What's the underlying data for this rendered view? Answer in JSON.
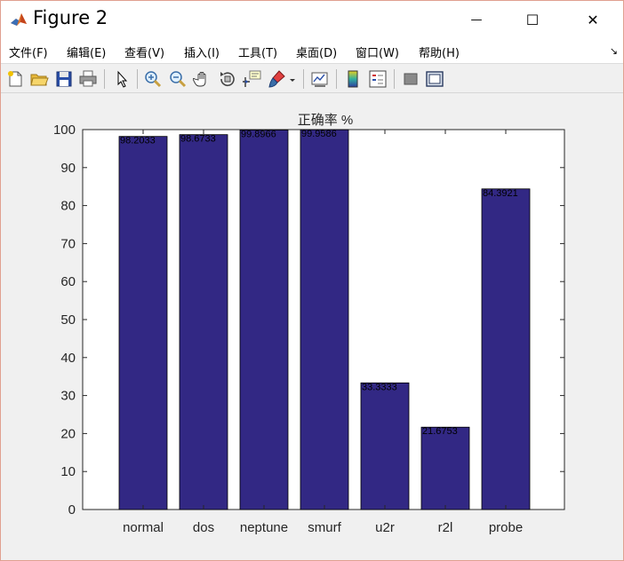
{
  "window": {
    "title": "Figure 2",
    "minimize_glyph": "—",
    "maximize_glyph": "☐",
    "close_glyph": "✕"
  },
  "menu": {
    "items": [
      "文件(F)",
      "编辑(E)",
      "查看(V)",
      "插入(I)",
      "工具(T)",
      "桌面(D)",
      "窗口(W)",
      "帮助(H)"
    ],
    "corner_glyph": "↘"
  },
  "toolbar": {
    "icons": [
      "new-figure-icon",
      "open-file-icon",
      "save-icon",
      "print-icon",
      "edit-plot-arrow-icon",
      "zoom-in-icon",
      "zoom-out-icon",
      "pan-hand-icon",
      "rotate-3d-icon",
      "data-cursor-icon",
      "brush-icon",
      "brush-dropdown-icon",
      "link-plot-icon",
      "colorbar-icon",
      "legend-icon",
      "hide-plot-tools-icon",
      "show-plot-tools-icon"
    ]
  },
  "colors": {
    "bar": "#322884",
    "axes_bg": "#ffffff",
    "figure_bg": "#f0f0f0"
  },
  "chart_data": {
    "type": "bar",
    "title": "正确率 %",
    "categories": [
      "normal",
      "dos",
      "neptune",
      "smurf",
      "u2r",
      "r2l",
      "probe"
    ],
    "values": [
      98.2033,
      98.6733,
      99.8966,
      99.9586,
      33.3333,
      21.6753,
      84.3921
    ],
    "value_labels": [
      "98.2033",
      "98.6733",
      "99.8966",
      "99.9586",
      "33.3333",
      "21.6753",
      "84.3921"
    ],
    "yticks": [
      0,
      10,
      20,
      30,
      40,
      50,
      60,
      70,
      80,
      90,
      100
    ],
    "ylim": [
      0,
      100
    ],
    "grid": false,
    "xlabel": "",
    "ylabel": ""
  }
}
